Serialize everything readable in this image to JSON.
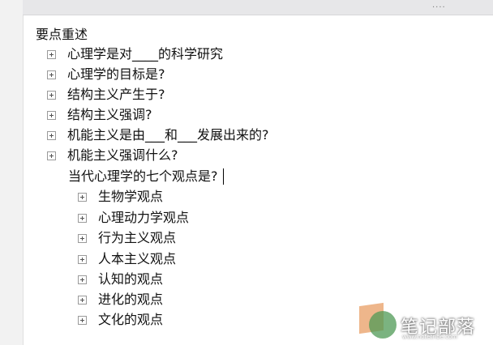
{
  "outline": {
    "root": "要点重述",
    "items": [
      "心理学是对____的科学研究",
      "心理学的目标是?",
      "结构主义产生于?",
      "结构主义强调?",
      "机能主义是由___和___发展出来的?",
      "机能主义强调什么?"
    ],
    "sub_heading": "当代心理学的七个观点是?",
    "sub_items": [
      "生物学观点",
      "心理动力学观点",
      "行为主义观点",
      "人本主义观点",
      "认知的观点",
      "进化的观点",
      "文化的观点"
    ]
  },
  "watermark": {
    "text": "笔记部落",
    "sub": "www.notetribe.com"
  }
}
